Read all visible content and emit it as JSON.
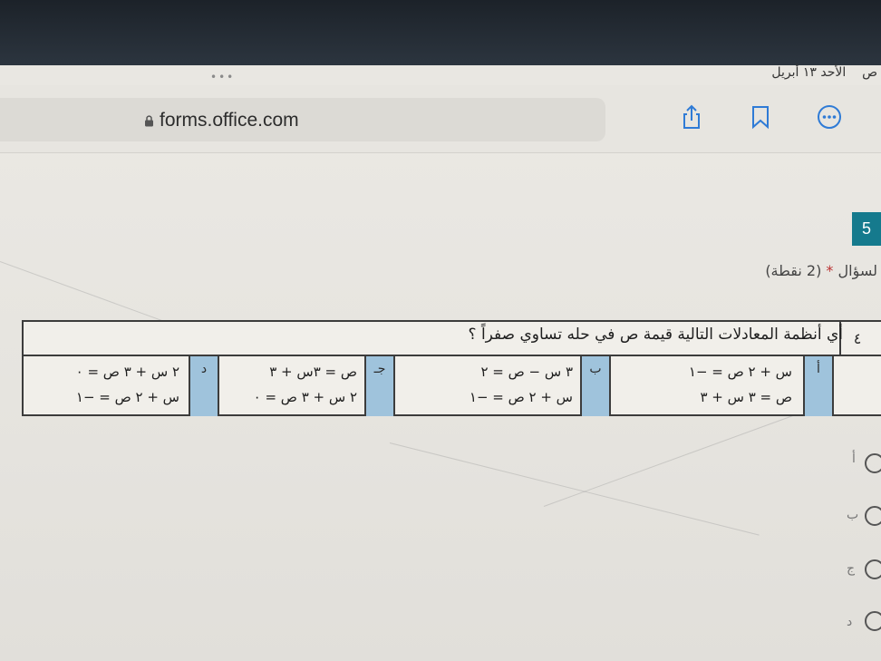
{
  "status": {
    "date": "الأحد ١٣ أبريل",
    "left_char": "ص"
  },
  "browser": {
    "url": "forms.office.com",
    "more_dots": "•••"
  },
  "icons": {
    "lock": "lock-icon",
    "share": "share-icon",
    "bookmark": "bookmark-icon",
    "more": "more-icon"
  },
  "colors": {
    "accent": "#157a8d",
    "option_header": "#9fc3dc",
    "icon_blue": "#2f7bd6"
  },
  "question": {
    "number": "5",
    "label": "لسؤال",
    "star": "*",
    "points": "(2 نقطة)",
    "item_number": "٤",
    "text": "أي أنظمة المعادلات التالية قيمة ص في حله تساوي صفراً ؟",
    "options": [
      {
        "letter": "أ",
        "line1": "س + ٢ ص = −١",
        "line2": "ص = ٣ س + ٣"
      },
      {
        "letter": "ب",
        "line1": "٣ س − ص = ٢",
        "line2": "س + ٢ ص = −١"
      },
      {
        "letter": "جـ",
        "line1": "ص = ٣س + ٣",
        "line2": "٢ س + ٣ ص = ٠"
      },
      {
        "letter": "د",
        "line1": "٢ س + ٣ ص = ٠",
        "line2": "س + ٢ ص = −١"
      }
    ]
  },
  "answers": [
    {
      "label": "أ"
    },
    {
      "label": "ب"
    },
    {
      "label": "ج"
    },
    {
      "label": "د"
    }
  ]
}
